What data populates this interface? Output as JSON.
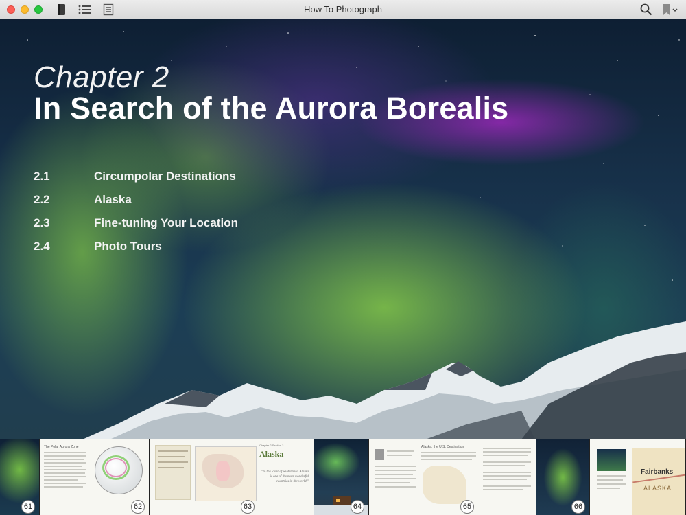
{
  "window": {
    "title": "How To Photograph"
  },
  "toolbar": {
    "left_icons": [
      "library-icon",
      "table-of-contents-icon",
      "notes-icon"
    ],
    "right_icons": [
      "search-icon",
      "bookmark-icon"
    ]
  },
  "hero": {
    "chapter_label": "Chapter 2",
    "chapter_title": "In Search of the Aurora Borealis",
    "toc": [
      {
        "num": "2.1",
        "label": "Circumpolar Destinations"
      },
      {
        "num": "2.2",
        "label": "Alaska"
      },
      {
        "num": "2.3",
        "label": "Fine-tuning Your Location"
      },
      {
        "num": "2.4",
        "label": "Photo Tours"
      }
    ]
  },
  "filmstrip": {
    "pages": [
      {
        "num": "61",
        "kind": "photo"
      },
      {
        "num": "62",
        "kind": "page"
      },
      {
        "num": "63",
        "kind": "page"
      },
      {
        "num": "64",
        "kind": "photo"
      },
      {
        "num": "65",
        "kind": "page"
      },
      {
        "num": "66",
        "kind": "photo"
      },
      {
        "num": "",
        "kind": "page"
      }
    ],
    "page_titles": {
      "p62": "The Polar Aurora Zone",
      "p63_chapter": "Chapter 2 Section 2",
      "p63_title": "Alaska",
      "p63_quote": "\"To the lover of wilderness, Alaska is one of the most wonderful countries in the world.\"",
      "p65_title": "Alaska, the U.S. Destination",
      "map_city": "Fairbanks",
      "map_region": "ALASKA"
    }
  }
}
